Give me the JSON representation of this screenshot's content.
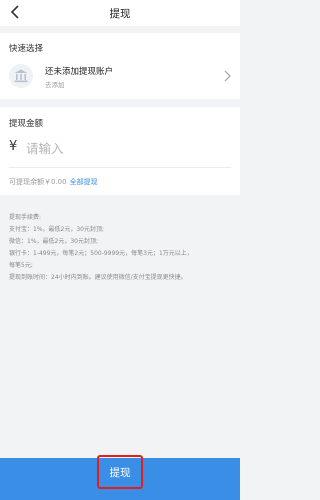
{
  "header": {
    "title": "提现",
    "back_icon": "chevron-left-icon"
  },
  "quick_select": {
    "label": "快速选择",
    "account_main": "还未添加提现账户",
    "account_sub": "去添加",
    "icon": "bank-icon"
  },
  "amount": {
    "label": "提现金额",
    "currency": "¥",
    "placeholder": "请输入",
    "balance_text": "可提现余额￥0.00",
    "withdraw_all": "全部提现"
  },
  "fees": {
    "lines": [
      "提现手续费:",
      "支付宝：1%，最低2元，30元封顶;",
      "微信：1%，最低2元，30元封顶;",
      "银行卡：1-499元，每笔2元；500-9999元，每笔3元；1万元以上，",
      "每笔5元;",
      "提现到账时间：24小时内到账。建议使用微信/支付宝提现更快捷。"
    ]
  },
  "submit": {
    "label": "提现"
  },
  "colors": {
    "accent": "#3a8ee6",
    "highlight": "#e02020"
  }
}
